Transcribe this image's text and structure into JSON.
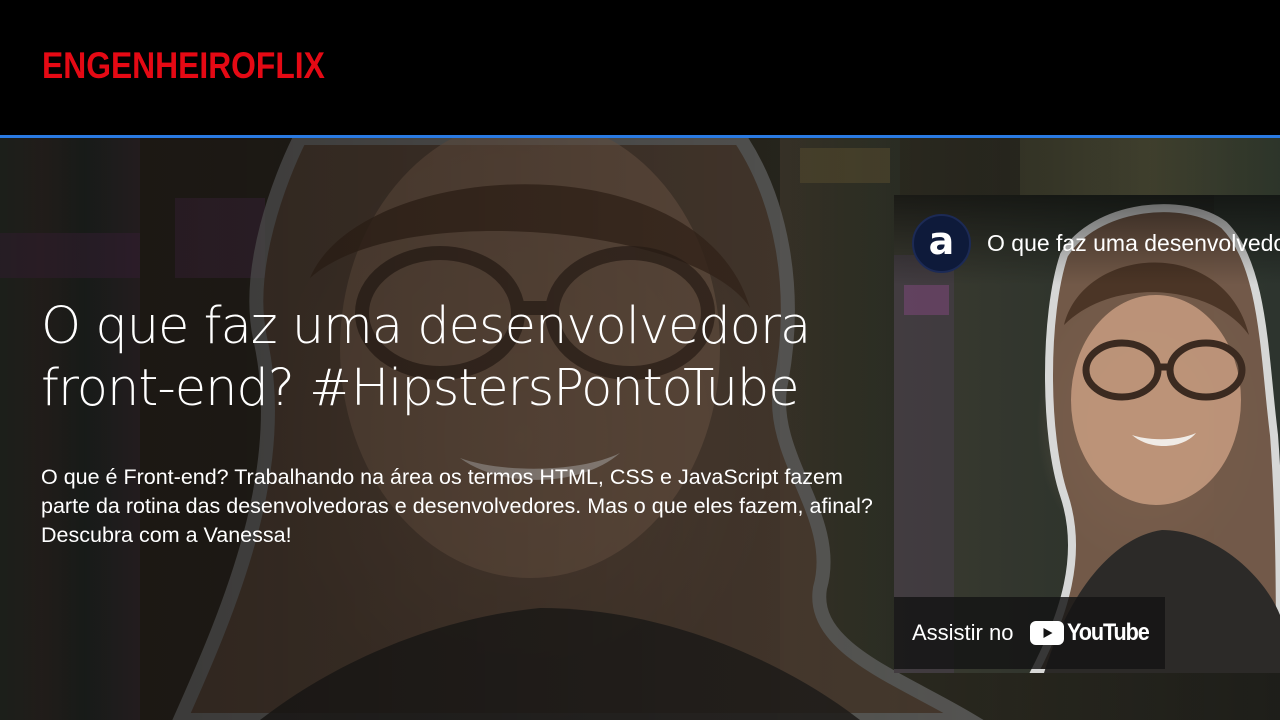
{
  "brand": {
    "logo_text": "ENGENHEIROFLIX",
    "logo_color": "#e50914"
  },
  "header": {
    "divider_color": "#2a7ae2"
  },
  "banner": {
    "title": "O que faz uma desenvolvedora front-end? #HipstersPontoTube",
    "description": "O que é Front-end? Trabalhando na área os termos HTML, CSS e JavaScript fazem parte da rotina das desenvolvedoras e desenvolvedores. Mas o que eles fazem, afinal? Descubra com a Vanessa!"
  },
  "video": {
    "channel_avatar_letter": "a",
    "title": "O que faz uma desenvolvedora front-end? #HipstersPontoTube",
    "watch_on_label": "Assistir no",
    "platform_name": "YouTube",
    "platform_icon": "youtube-play-icon"
  }
}
